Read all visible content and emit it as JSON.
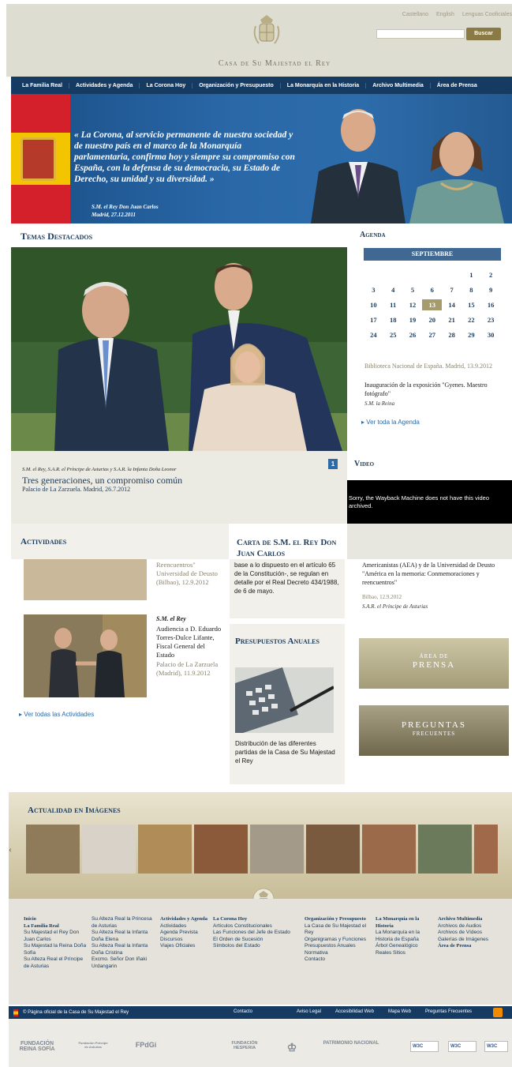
{
  "header": {
    "languages": [
      "Castellano",
      "English",
      "Lenguas Cooficiales"
    ],
    "search_button": "Buscar",
    "site_title": "Casa de Su Majestad el Rey"
  },
  "nav": [
    "La Familia Real",
    "Actividades y Agenda",
    "La Corona Hoy",
    "Organización y Presupuesto",
    "La Monarquía en la Historia",
    "Archivo Multimedia",
    "Área de Prensa"
  ],
  "hero": {
    "quote": "« La Corona, al servicio permanente de nuestra sociedad y de nuestro país en el marco de la Monarquía parlamentaria, confirma hoy y siempre su compromiso con España, con la defensa de su democracia, su Estado de Derecho, su unidad y su diversidad. »",
    "author": "S.M. el Rey Don Juan Carlos",
    "date": "Madrid, 27.12.2011"
  },
  "temas": {
    "title": "Temas Destacados",
    "caption": "S.M. el Rey, S.A.R. el Príncipe de Asturias y S.A.R. la Infanta Doña Leonor",
    "headline": "Tres generaciones, un compromiso común",
    "place": "Palacio de La Zarzuela. Madrid, 26.7.2012",
    "page_num": "1"
  },
  "agenda": {
    "title": "Agenda",
    "month": "SEPTIEMBRE",
    "days": [
      "",
      "",
      "",
      "",
      "",
      "1",
      "2",
      "3",
      "4",
      "5",
      "6",
      "7",
      "8",
      "9",
      "10",
      "11",
      "12",
      "13",
      "14",
      "15",
      "16",
      "17",
      "18",
      "19",
      "20",
      "21",
      "22",
      "23",
      "24",
      "25",
      "26",
      "27",
      "28",
      "29",
      "30"
    ],
    "today": "13",
    "event_place": "Biblioteca Nacional de España. Madrid, 13.9.2012",
    "event_title": "Inauguración de la exposición \"Gyenes. Maestro fotógrafo\"",
    "event_who": "S.M. la Reina",
    "link": "Ver toda la Agenda"
  },
  "video": {
    "title": "Video",
    "message": "Sorry, the Wayback Machine does not have this video archived."
  },
  "actividades": {
    "title": "Actividades",
    "item1_text": "Reencuentros\" Universidad de Deusto (Bilbao), 12.9.2012",
    "item2_who": "S.M. el Rey",
    "item2_text": "Audiencia a D. Eduardo Torres-Dulce Lifante, Fiscal General del Estado",
    "item2_place": "Palacio de La Zarzuela (Madrid), 11.9.2012",
    "link": "Ver todas las Actividades"
  },
  "carta": {
    "title": "Carta de S.M. el Rey Don Juan Carlos",
    "text": "base a lo dispuesto en el artículo 65 de la Constitución-, se regulan en detalle por el Real Decreto 434/1988, de 6 de mayo."
  },
  "presupuestos": {
    "title": "Presupuestos Anuales",
    "text": "Distribución de las diferentes partidas de la Casa de Su Majestad el Rey"
  },
  "right_event": {
    "text": "Americanistas (AEA) y de la Universidad de Deusto \"América en la memoria: Conmemoraciones y reencuentros\"",
    "date": "Bilbao, 12.9.2012",
    "who": "S.A.R. el Príncipe de Asturias"
  },
  "buttons": {
    "prensa_small": "ÁREA DE",
    "prensa": "PRENSA",
    "faq": "PREGUNTAS",
    "faq_small": "FRECUENTES"
  },
  "gallery": {
    "title": "Actualidad en Imágenes"
  },
  "footer": {
    "col1": [
      "Inicio",
      "La Familia Real",
      "Su Majestad el Rey Don Juan Carlos",
      "Su Majestad la Reina Doña Sofía",
      "Su Alteza Real el Príncipe de Asturias"
    ],
    "col2": [
      "Su Alteza Real la Princesa de Asturias",
      "Su Alteza Real la Infanta Doña Elena",
      "Su Alteza Real la Infanta Doña Cristina",
      "Excmo. Señor Don Iñaki Urdangarin"
    ],
    "col3": [
      "Actividades y Agenda",
      "Actividades",
      "Agenda Prevista",
      "Discursos",
      "Viajes Oficiales"
    ],
    "col4": [
      "La Corona Hoy",
      "Artículos Constitucionales",
      "Las Funciones del Jefe de Estado",
      "El Orden de Sucesión",
      "Símbolos del Estado"
    ],
    "col5": [
      "Organización y Presupuesto",
      "La Casa de Su Majestad el Rey",
      "Organigramas y Funciones",
      "Presupuestos Anuales",
      "Normativa",
      "Contacto"
    ],
    "col6": [
      "La Monarquía en la Historia",
      "La Monarquía en la Historia de España",
      "Árbol Genealógico",
      "Reales Sitios"
    ],
    "col7": [
      "Archivo Multimedia",
      "Archivos de Audios",
      "Archivos de Vídeos",
      "Galerías de Imágenes",
      "Área de Prensa"
    ],
    "bar_site": "© Página oficial de la Casa de Su Majestad el Rey",
    "bar_contact": "Contacto",
    "bar_legal": "Aviso Legal",
    "bar_access": "Accesibilidad Web",
    "bar_map": "Mapa Web",
    "bar_faq": "Preguntas Frecuentes",
    "logo1": "FUNDACIÓN REINA SOFÍA",
    "logo2": "Fundación Príncipe de Asturias",
    "logo3": "FPdGi",
    "logo4": "FUNDACIÓN HESPERIA",
    "logo6": "PATRIMONIO NACIONAL",
    "w3c1": "W3C",
    "w3c2": "W3C",
    "w3c3": "W3C"
  }
}
